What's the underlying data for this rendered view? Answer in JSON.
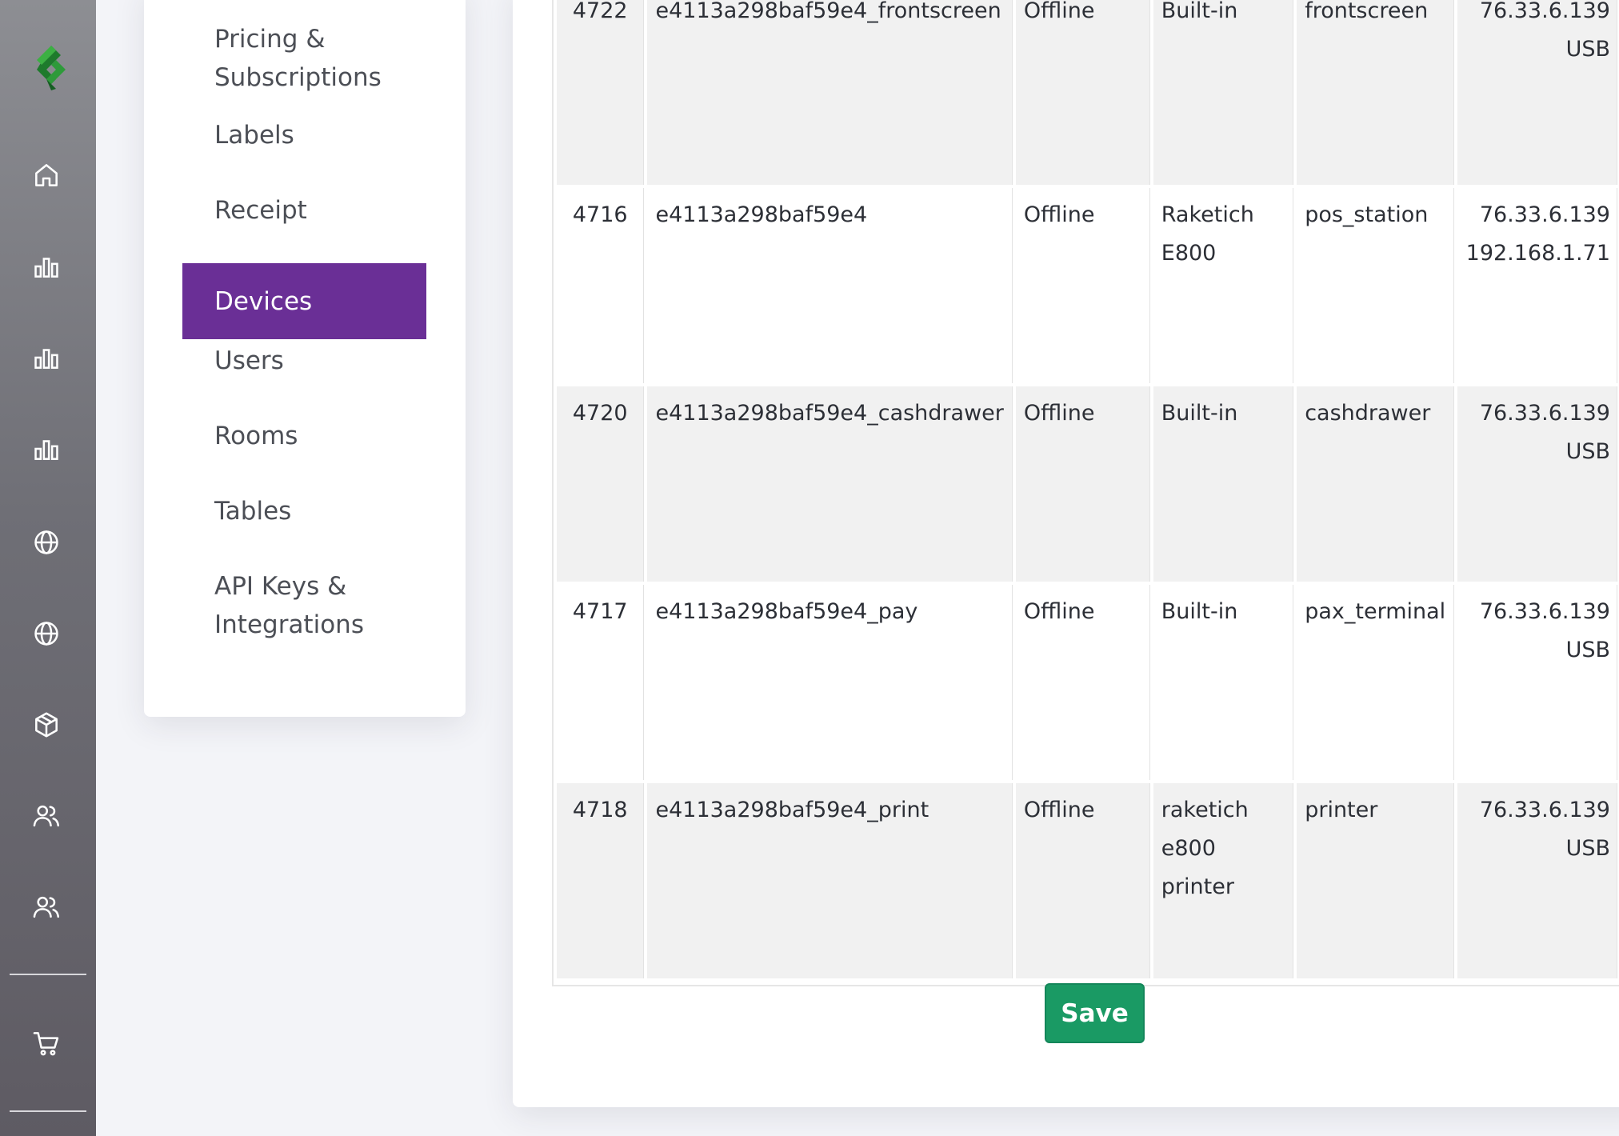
{
  "sidebar": {
    "icons": [
      "logo-icon",
      "home-icon",
      "bar-chart-icon",
      "bar-chart-icon",
      "bar-chart-icon",
      "globe-icon",
      "globe-icon",
      "box-icon",
      "users-icon",
      "users-icon",
      "cart-icon"
    ]
  },
  "settings_nav": {
    "items": [
      {
        "label": "Pricing &\nSubscriptions"
      },
      {
        "label": "Labels"
      },
      {
        "label": "Receipt"
      },
      {
        "label": "Devices"
      },
      {
        "label": "Users"
      },
      {
        "label": "Rooms"
      },
      {
        "label": "Tables"
      },
      {
        "label": "API Keys &\nIntegrations"
      }
    ],
    "active": "Devices"
  },
  "devices_table": {
    "rows": [
      {
        "id": "4722",
        "name": "e4113a298baf59e4_frontscreen",
        "status": "Offline",
        "model": "Built-in",
        "type": "frontscreen",
        "address": "76.33.6.139\nUSB"
      },
      {
        "id": "4716",
        "name": "e4113a298baf59e4",
        "status": "Offline",
        "model": "Raketich\nE800",
        "type": "pos_station",
        "address": "76.33.6.139\n192.168.1.71"
      },
      {
        "id": "4720",
        "name": "e4113a298baf59e4_cashdrawer",
        "status": "Offline",
        "model": "Built-in",
        "type": "cashdrawer",
        "address": "76.33.6.139\nUSB"
      },
      {
        "id": "4717",
        "name": "e4113a298baf59e4_pay",
        "status": "Offline",
        "model": "Built-in",
        "type": "pax_terminal",
        "address": "76.33.6.139\nUSB"
      },
      {
        "id": "4718",
        "name": "e4113a298baf59e4_print",
        "status": "Offline",
        "model": "raketich\ne800 printer",
        "type": "printer",
        "address": "76.33.6.139\nUSB"
      }
    ]
  },
  "actions": {
    "save_label": "Save"
  },
  "colors": {
    "active_nav": "#6a2f96",
    "save_button": "#1a9a64",
    "logo_green": "#2e9a3a"
  }
}
